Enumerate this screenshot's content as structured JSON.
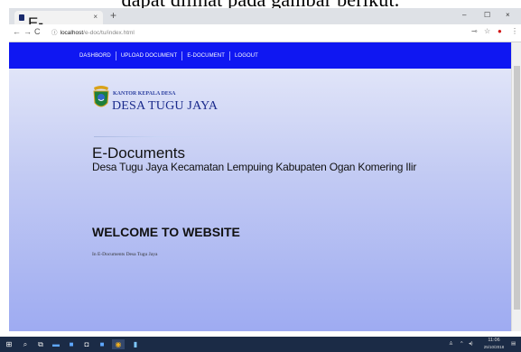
{
  "page_caption": "dapat dilihat pada gambar berikut.",
  "browser": {
    "tab_title": "E-Documents | Home",
    "tab_close": "×",
    "new_tab": "+",
    "window_controls": [
      "–",
      "☐",
      "×"
    ],
    "nav": {
      "back": "←",
      "forward": "→",
      "reload": "C"
    },
    "url_host": "localhost",
    "url_path": "/e-doc/tu/index.html",
    "toolbar_icons": [
      "key-icon",
      "star-icon",
      "extension-icon",
      "menu-icon"
    ]
  },
  "site": {
    "nav": [
      "DASHBORD",
      "UPLOAD DOCUMENT",
      "E-DOCUMENT",
      "LOGOUT"
    ],
    "logo_small": "KANTOR KEPALA DESA",
    "logo_big": "DESA TUGU JAYA",
    "title": "E-Documents",
    "subtitle": "Desa Tugu Jaya Kecamatan Lempuing Kabupaten Ogan Komering Ilir",
    "welcome": "WELCOME TO WEBSITE",
    "welcome_sub": "In E-Documents Desa Tugu Jaya"
  },
  "taskbar": {
    "clock_time": "11:06",
    "clock_date": "25/10/2018"
  },
  "colors": {
    "navbar": "#0f17f2",
    "taskbar": "#1b2b46",
    "logo_text": "#1a2a8c"
  }
}
